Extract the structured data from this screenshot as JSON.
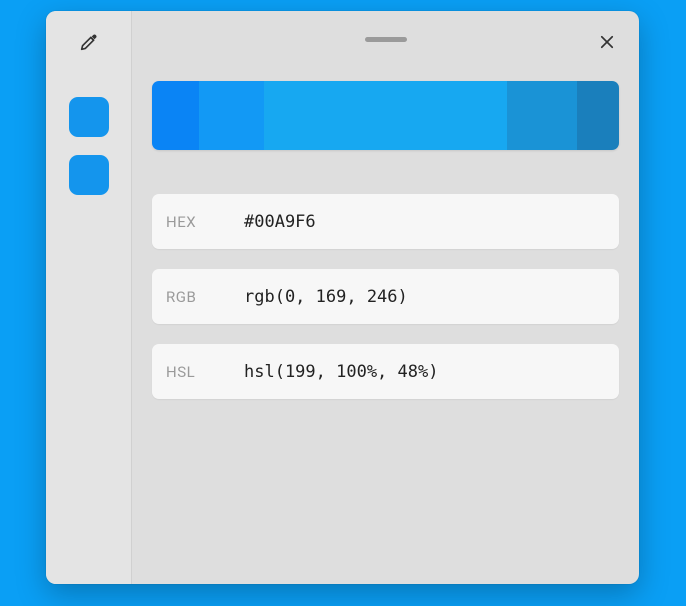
{
  "sidebar": {
    "swatches": [
      {
        "color": "#1495ed"
      },
      {
        "color": "#1495ed"
      }
    ]
  },
  "shades": [
    {
      "color": "#0a84f5",
      "width": 10
    },
    {
      "color": "#1299f5",
      "width": 14
    },
    {
      "color": "#17a8f1",
      "width": 52
    },
    {
      "color": "#1a93d6",
      "width": 15
    },
    {
      "color": "#1a7fbc",
      "width": 9
    }
  ],
  "rows": {
    "hex": {
      "label": "HEX",
      "value": "#00A9F6"
    },
    "rgb": {
      "label": "RGB",
      "value": "rgb(0, 169, 246)"
    },
    "hsl": {
      "label": "HSL",
      "value": "hsl(199, 100%, 48%)"
    }
  }
}
